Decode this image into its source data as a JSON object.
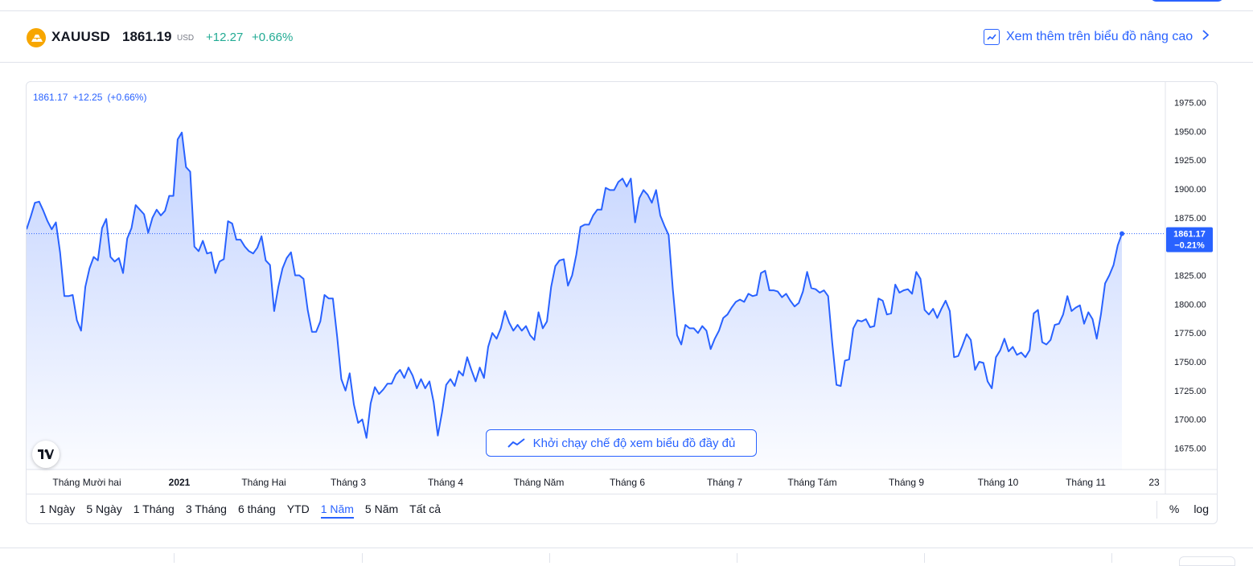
{
  "header": {
    "symbol": "XAUUSD",
    "price": "1861.19",
    "currency": "USD",
    "change": "+12.27",
    "change_percent": "+0.66%",
    "advanced_link": "Xem thêm trên biểu đồ nâng cao"
  },
  "legend": {
    "price": "1861.17",
    "change": "+12.25",
    "change_percent": "(+0.66%)"
  },
  "price_label": {
    "price": "1861.17",
    "change": "−0.21%"
  },
  "launch_button": "Khởi chạy chế độ xem biểu đồ đầy đủ",
  "ranges": [
    "1 Ngày",
    "5 Ngày",
    "1 Tháng",
    "3 Tháng",
    "6 tháng",
    "YTD",
    "1 Năm",
    "5 Năm",
    "Tất cả"
  ],
  "active_range": "1 Năm",
  "scale_options": [
    "%",
    "log"
  ],
  "colors": {
    "line": "#2962ff",
    "up": "#22ab94",
    "accent": "#2962ff"
  },
  "chart_data": {
    "type": "area",
    "y_ticks": [
      1675,
      1700,
      1725,
      1750,
      1775,
      1800,
      1825,
      1850,
      1875,
      1900,
      1925,
      1950,
      1975
    ],
    "ylim": [
      1660,
      1990
    ],
    "x_tick_labels": [
      "Tháng Mười hai",
      "2021",
      "Tháng Hai",
      "Tháng 3",
      "Tháng 4",
      "Tháng Năm",
      "Tháng 6",
      "Tháng 7",
      "Tháng Tám",
      "Tháng 9",
      "Tháng 10",
      "Tháng 11",
      "23"
    ],
    "last_value": 1861.17,
    "grid": false,
    "series": [
      {
        "values": [
          1865,
          1876,
          1888,
          1889,
          1881,
          1872,
          1865,
          1871,
          1845,
          1807,
          1807,
          1808,
          1786,
          1777,
          1815,
          1831,
          1841,
          1838,
          1866,
          1874,
          1841,
          1837,
          1840,
          1827,
          1857,
          1866,
          1886,
          1882,
          1878,
          1862,
          1875,
          1882,
          1877,
          1881,
          1894,
          1894,
          1943,
          1949,
          1919,
          1915,
          1850,
          1846,
          1855,
          1844,
          1845,
          1827,
          1837,
          1839,
          1872,
          1870,
          1856,
          1856,
          1850,
          1846,
          1844,
          1849,
          1859,
          1838,
          1834,
          1794,
          1815,
          1831,
          1840,
          1845,
          1825,
          1825,
          1822,
          1795,
          1776,
          1776,
          1785,
          1808,
          1805,
          1805,
          1772,
          1735,
          1725,
          1740,
          1713,
          1697,
          1700,
          1684,
          1714,
          1728,
          1722,
          1726,
          1731,
          1731,
          1739,
          1743,
          1736,
          1745,
          1738,
          1727,
          1735,
          1727,
          1733,
          1715,
          1686,
          1706,
          1730,
          1735,
          1729,
          1742,
          1738,
          1754,
          1743,
          1733,
          1745,
          1736,
          1763,
          1775,
          1770,
          1779,
          1794,
          1784,
          1777,
          1782,
          1777,
          1781,
          1773,
          1769,
          1793,
          1779,
          1785,
          1815,
          1833,
          1838,
          1839,
          1816,
          1825,
          1843,
          1867,
          1869,
          1869,
          1877,
          1882,
          1882,
          1901,
          1899,
          1899,
          1906,
          1909,
          1902,
          1909,
          1871,
          1892,
          1899,
          1895,
          1888,
          1899,
          1877,
          1868,
          1860,
          1813,
          1773,
          1765,
          1782,
          1779,
          1779,
          1775,
          1781,
          1777,
          1761,
          1770,
          1777,
          1788,
          1791,
          1797,
          1802,
          1804,
          1802,
          1809,
          1807,
          1808,
          1827,
          1829,
          1812,
          1812,
          1811,
          1806,
          1809,
          1803,
          1798,
          1801,
          1811,
          1828,
          1814,
          1813,
          1810,
          1812,
          1807,
          1766,
          1730,
          1729,
          1751,
          1752,
          1779,
          1786,
          1785,
          1787,
          1780,
          1781,
          1805,
          1803,
          1791,
          1792,
          1817,
          1810,
          1812,
          1813,
          1809,
          1828,
          1822,
          1795,
          1791,
          1796,
          1788,
          1796,
          1803,
          1794,
          1754,
          1755,
          1764,
          1774,
          1769,
          1743,
          1750,
          1749,
          1733,
          1727,
          1754,
          1760,
          1770,
          1759,
          1763,
          1756,
          1758,
          1754,
          1760,
          1792,
          1795,
          1767,
          1765,
          1769,
          1782,
          1783,
          1791,
          1807,
          1794,
          1797,
          1799,
          1783,
          1793,
          1787,
          1770,
          1791,
          1818,
          1825,
          1834,
          1851,
          1861.17
        ]
      }
    ]
  }
}
